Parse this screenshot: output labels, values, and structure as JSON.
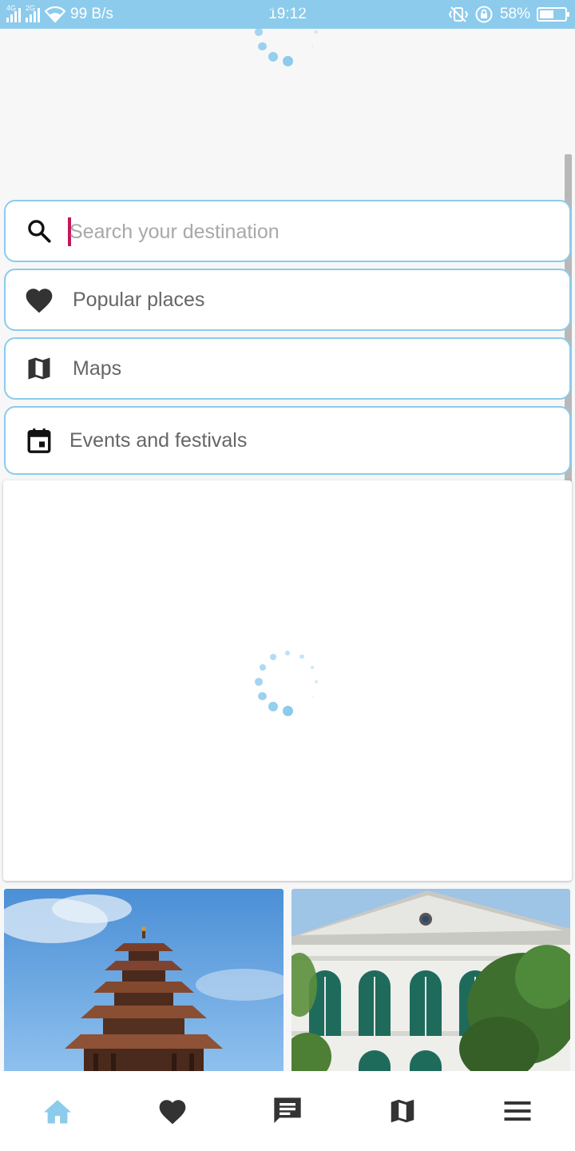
{
  "status_bar": {
    "network_1": "4G",
    "network_2": "2G",
    "data_speed": "99 B/s",
    "time": "19:12",
    "battery_percent": "58%",
    "battery_level": 0.58,
    "icons": [
      "signal-4g-icon",
      "signal-2g-icon",
      "wifi-icon",
      "vibrate-icon",
      "rotation-lock-icon",
      "battery-icon"
    ]
  },
  "search": {
    "placeholder": "Search your destination",
    "value": "",
    "icon": "search-icon"
  },
  "menu": {
    "items": [
      {
        "label": "Popular places",
        "icon": "heart-icon"
      },
      {
        "label": "Maps",
        "icon": "map-icon"
      },
      {
        "label": "Events and festivals",
        "icon": "calendar-icon"
      }
    ]
  },
  "gallery": {
    "items": [
      {
        "subject": "pagoda-temple-image"
      },
      {
        "subject": "white-building-image"
      }
    ]
  },
  "bottom_nav": {
    "items": [
      {
        "icon": "home-icon",
        "active": true
      },
      {
        "icon": "heart-icon",
        "active": false
      },
      {
        "icon": "chat-icon",
        "active": false
      },
      {
        "icon": "map-icon",
        "active": false
      },
      {
        "icon": "menu-icon",
        "active": false
      }
    ]
  },
  "colors": {
    "accent": "#8ccbec",
    "icon_dark": "#333333",
    "caret": "#c2185b",
    "label": "#666666"
  }
}
